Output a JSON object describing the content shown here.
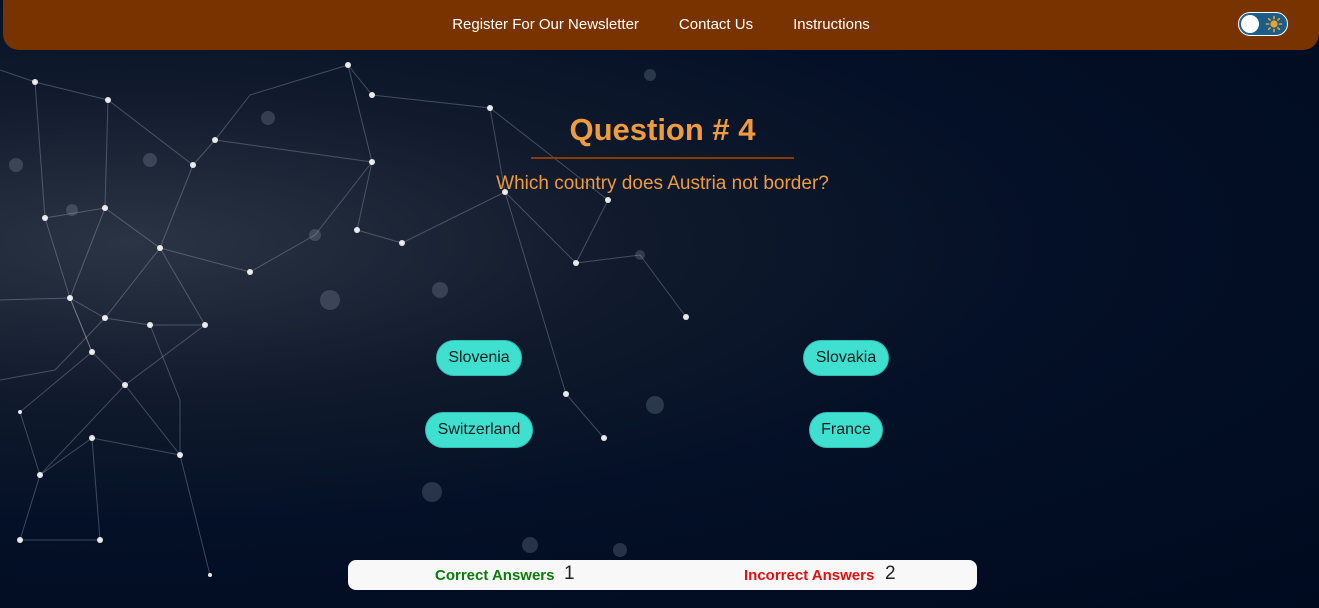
{
  "nav": {
    "links": [
      "Register For Our Newsletter",
      "Contact Us",
      "Instructions"
    ]
  },
  "theme_toggle": {
    "icon": "sun-icon"
  },
  "quiz": {
    "title": "Question # 4",
    "question": "Which country does Austria not border?",
    "answers": [
      "Slovenia",
      "Slovakia",
      "Switzerland",
      "France"
    ]
  },
  "score": {
    "correct_label": "Correct Answers",
    "correct_value": "1",
    "incorrect_label": "Incorrect Answers",
    "incorrect_value": "2"
  },
  "colors": {
    "navbar": "#793300",
    "accent": "#ef9b3e",
    "answer_button": "#40e0d0",
    "correct": "#0a7a0a",
    "incorrect": "#e01010",
    "background": "#000b1f"
  }
}
